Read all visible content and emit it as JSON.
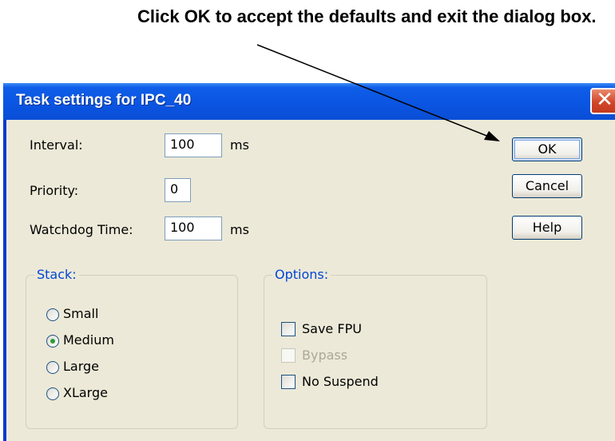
{
  "callout": {
    "text": "Click OK to accept the defaults and exit the dialog box."
  },
  "window": {
    "title": "Task settings for IPC_40",
    "close_glyph": "✕"
  },
  "fields": {
    "interval": {
      "label": "Interval:",
      "value": "100",
      "unit": "ms"
    },
    "priority": {
      "label": "Priority:",
      "value": "0"
    },
    "watchdog": {
      "label": "Watchdog Time:",
      "value": "100",
      "unit": "ms"
    }
  },
  "buttons": {
    "ok": "OK",
    "cancel": "Cancel",
    "help": "Help"
  },
  "stack": {
    "legend": "Stack:",
    "selected": "Medium",
    "options": [
      "Small",
      "Medium",
      "Large",
      "XLarge"
    ]
  },
  "options": {
    "legend": "Options:",
    "items": [
      {
        "label": "Save FPU",
        "checked": false,
        "enabled": true
      },
      {
        "label": "Bypass",
        "checked": false,
        "enabled": false
      },
      {
        "label": "No Suspend",
        "checked": false,
        "enabled": true
      }
    ]
  },
  "colors": {
    "titlebar": "#0a54e1",
    "dialog_face": "#ece9d8",
    "group_legend": "#0046d5",
    "close_button": "#d2472b"
  },
  "icons": {
    "close": "close-icon",
    "radio_selected": "radio-selected-icon",
    "arrow": "callout-arrow-icon"
  }
}
